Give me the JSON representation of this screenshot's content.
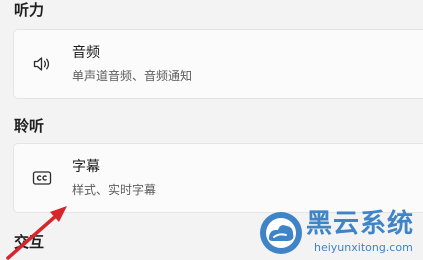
{
  "sections": {
    "hearing": {
      "title": "听力"
    },
    "listening": {
      "title": "聆听"
    },
    "interaction": {
      "title": "交互"
    }
  },
  "cards": {
    "audio": {
      "icon": "speaker-icon",
      "title": "音频",
      "subtitle": "单声道音频、音频通知"
    },
    "captions": {
      "icon": "closed-caption-icon",
      "title": "字幕",
      "subtitle": "样式、实时字幕"
    }
  },
  "annotation": {
    "icon": "red-arrow-icon",
    "color": "#d7262b"
  },
  "watermark": {
    "icon": "heiyun-logo-icon",
    "name": "黑云系统",
    "url": "heiyunxitong.com",
    "color": "#3f84c6"
  }
}
